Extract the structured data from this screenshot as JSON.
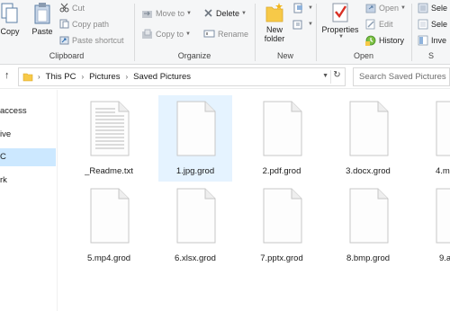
{
  "ribbon": {
    "clipboard": {
      "copy": "Copy",
      "paste": "Paste",
      "cut": "Cut",
      "copy_path": "Copy path",
      "paste_shortcut": "Paste shortcut",
      "label": "Clipboard"
    },
    "organize": {
      "move_to": "Move to",
      "copy_to": "Copy to",
      "delete": "Delete",
      "rename": "Rename",
      "label": "Organize"
    },
    "new": {
      "new_folder_line1": "New",
      "new_folder_line2": "folder",
      "label": "New"
    },
    "open": {
      "properties": "Properties",
      "open": "Open",
      "edit": "Edit",
      "history": "History",
      "label": "Open"
    },
    "select": {
      "select_all": "Sele",
      "select_none": "Sele",
      "invert": "Inve",
      "label": "S"
    }
  },
  "address": {
    "crumbs": [
      "This PC",
      "Pictures",
      "Saved Pictures"
    ],
    "search_placeholder": "Search Saved Pictures"
  },
  "navpane": {
    "items": [
      "access",
      "ive",
      "C",
      "rk"
    ]
  },
  "files": [
    {
      "name": "_Readme.txt",
      "icon": "text-document-icon"
    },
    {
      "name": "1.jpg.grod",
      "icon": "blank-document-icon"
    },
    {
      "name": "2.pdf.grod",
      "icon": "blank-document-icon"
    },
    {
      "name": "3.docx.grod",
      "icon": "blank-document-icon"
    },
    {
      "name": "4.m",
      "icon": "blank-document-icon"
    },
    {
      "name": "5.mp4.grod",
      "icon": "blank-document-icon"
    },
    {
      "name": "6.xlsx.grod",
      "icon": "blank-document-icon"
    },
    {
      "name": "7.pptx.grod",
      "icon": "blank-document-icon"
    },
    {
      "name": "8.bmp.grod",
      "icon": "blank-document-icon"
    },
    {
      "name": "9.a",
      "icon": "blank-document-icon"
    }
  ],
  "colors": {
    "selected_tile": "#e5f3ff",
    "selected_nav": "#cce8ff",
    "folder": "#f7c948",
    "properties_check": "#d93025"
  }
}
